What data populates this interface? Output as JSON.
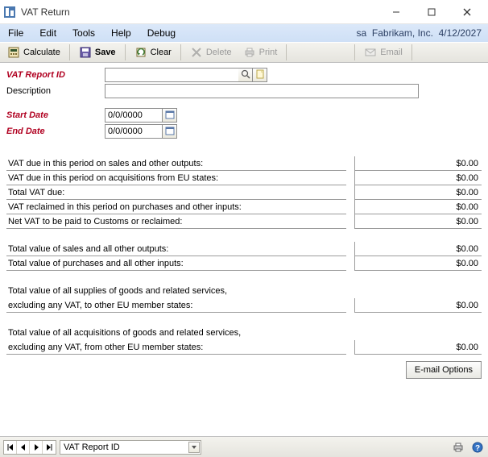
{
  "title": "VAT Return",
  "menus": [
    "File",
    "Edit",
    "Tools",
    "Help",
    "Debug"
  ],
  "status_user": "sa",
  "status_company": "Fabrikam, Inc.",
  "status_date": "4/12/2027",
  "toolbar": {
    "calculate": "Calculate",
    "save": "Save",
    "clear": "Clear",
    "delete": "Delete",
    "print": "Print",
    "email": "Email"
  },
  "form": {
    "vat_report_id_label": "VAT Report ID",
    "vat_report_id_value": "",
    "description_label": "Description",
    "description_value": "",
    "start_date_label": "Start Date",
    "start_date_value": "0/0/0000",
    "end_date_label": "End Date",
    "end_date_value": "0/0/0000"
  },
  "lines": {
    "l1": "VAT due in this period on sales and other outputs:",
    "l2": "VAT due in this period on acquisitions from EU states:",
    "l3": "Total VAT due:",
    "l4": "VAT reclaimed in this period on purchases and other inputs:",
    "l5": "Net VAT to be paid to Customs or reclaimed:",
    "l6": "Total value of sales and all other outputs:",
    "l7": "Total value of purchases and all other inputs:",
    "l8a": "Total value of all supplies of goods and related services,",
    "l8b": "excluding any VAT, to other EU member states:",
    "l9a": "Total value of all acquisitions of goods and related services,",
    "l9b": "excluding any VAT, from other EU member states:"
  },
  "values": {
    "v1": "$0.00",
    "v2": "$0.00",
    "v3": "$0.00",
    "v4": "$0.00",
    "v5": "$0.00",
    "v6": "$0.00",
    "v7": "$0.00",
    "v8": "$0.00",
    "v9": "$0.00"
  },
  "email_options_label": "E-mail Options",
  "sort_field": "VAT Report ID"
}
